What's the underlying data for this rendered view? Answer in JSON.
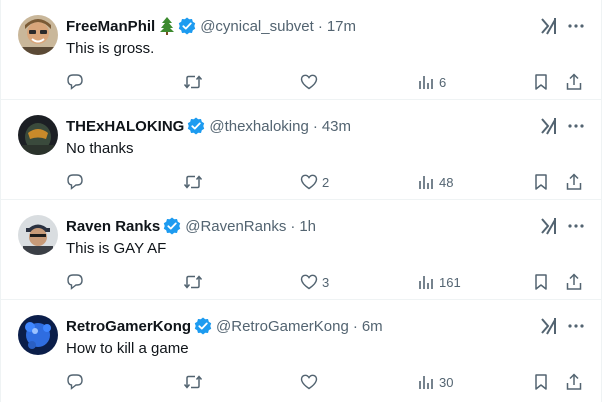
{
  "posts": [
    {
      "name": "FreeManPhil",
      "has_tree_emoji": true,
      "handle": "@cynical_subvet",
      "separator": "·",
      "time": "17m",
      "text": "This is gross.",
      "likes": "",
      "views": "6",
      "avatar_icon": "photo-avatar-man-smiling"
    },
    {
      "name": "THExHALOKING",
      "has_tree_emoji": false,
      "handle": "@thexhaloking",
      "separator": "·",
      "time": "43m",
      "text": "No thanks",
      "likes": "2",
      "views": "48",
      "avatar_icon": "photo-avatar-helmet"
    },
    {
      "name": "Raven Ranks",
      "has_tree_emoji": false,
      "handle": "@RavenRanks",
      "separator": "·",
      "time": "1h",
      "text": "This is GAY AF",
      "likes": "3",
      "views": "161",
      "avatar_icon": "photo-avatar-man-cap"
    },
    {
      "name": "RetroGamerKong",
      "has_tree_emoji": false,
      "handle": "@RetroGamerKong",
      "separator": "·",
      "time": "6m",
      "text": "How to kill a game",
      "likes": "",
      "views": "30",
      "avatar_icon": "photo-avatar-blue-orbs"
    }
  ],
  "colors": {
    "text_primary": "#0f1419",
    "text_secondary": "#536471",
    "verified_blue": "#1d9bf0",
    "divider": "#eff3f4"
  }
}
